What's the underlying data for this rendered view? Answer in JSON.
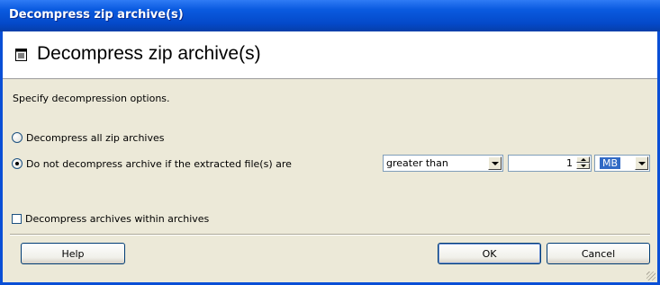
{
  "window": {
    "title": "Decompress zip archive(s)"
  },
  "header": {
    "title": "Decompress zip archive(s)",
    "icon": "dialog-doc-icon"
  },
  "description": "Specify decompression options.",
  "options": {
    "decompress_all": {
      "label": "Decompress all zip archives",
      "selected": false
    },
    "size_limit": {
      "label": "Do not decompress archive if the extracted file(s) are",
      "selected": true,
      "comparison": {
        "value": "greater than"
      },
      "amount": {
        "value": "1"
      },
      "unit": {
        "value": "MB"
      }
    },
    "nested": {
      "label": "Decompress archives within archives",
      "checked": false
    }
  },
  "buttons": {
    "help": "Help",
    "ok": "OK",
    "cancel": "Cancel"
  }
}
